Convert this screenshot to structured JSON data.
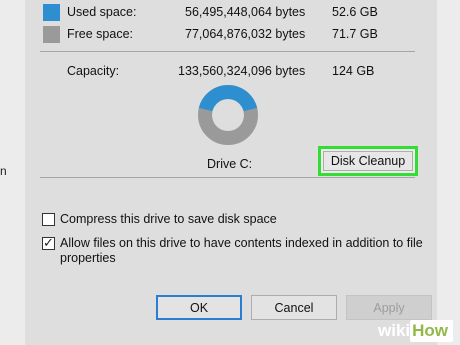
{
  "background_fragment": "n",
  "space": {
    "used": {
      "label": "Used space:",
      "bytes": "56,495,448,064 bytes",
      "size": "52.6 GB",
      "color": "#2e8fd0"
    },
    "free": {
      "label": "Free space:",
      "bytes": "77,064,876,032 bytes",
      "size": "71.7 GB",
      "color": "#9a9a9a"
    },
    "capacity": {
      "label": "Capacity:",
      "bytes": "133,560,324,096 bytes",
      "size": "124 GB"
    }
  },
  "drive": {
    "label": "Drive C:",
    "used_fraction": 0.423
  },
  "disk_cleanup_label": "Disk Cleanup",
  "options": {
    "compress": {
      "label": "Compress this drive to save disk space",
      "checked": false
    },
    "index_line1": "Allow files on this drive to have contents indexed in addition to file",
    "index_line2": "properties",
    "index_checked": true
  },
  "buttons": {
    "ok": "OK",
    "cancel": "Cancel",
    "apply": "Apply"
  },
  "watermark": {
    "wiki": "wiki",
    "how": "How"
  },
  "colors": {
    "highlight": "#33dd33",
    "ok_border": "#2b7cd3"
  }
}
